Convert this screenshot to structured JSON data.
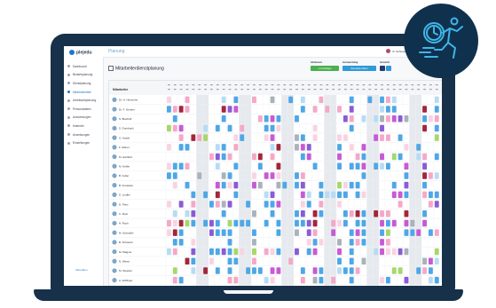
{
  "app": {
    "logo_text": "plejedu",
    "page_title": "Planung",
    "user_label": "R. Schneider · Pflegeheim Musterhaus"
  },
  "sidebar": {
    "items": [
      {
        "label": "Dashboard",
        "active": false
      },
      {
        "label": "Bedarfsplanung",
        "active": false
      },
      {
        "label": "Dienstplanung",
        "active": false
      },
      {
        "label": "Mitarbeiterliste",
        "active": true
      },
      {
        "label": "Arbeitszeitplanung",
        "active": false
      },
      {
        "label": "Personaldaten",
        "active": false
      },
      {
        "label": "Auswertungen",
        "active": false
      },
      {
        "label": "Kalender",
        "active": false
      },
      {
        "label": "Anweisungen",
        "active": false
      },
      {
        "label": "Einstellungen",
        "active": false
      }
    ],
    "logout_label": "Abmelden"
  },
  "toolbar": {
    "plan_title": "Mitarbeiterdienstplanung",
    "group1_label": "Aktionen",
    "group1_button": "+ Hinzufügen",
    "group2_label": "Auswertung",
    "group2_button": "Dienstplan filtern",
    "group3_label": "Ansicht",
    "colors": {
      "green": "#4cb050",
      "blue": "#2f9ad6",
      "navy": "#1f3b72"
    }
  },
  "grid": {
    "header_label": "Mitarbeiter",
    "employees": [
      "Dr. H. Heinrichs",
      "Dr. F. Gerster",
      "S. Bischoff",
      "S. Dornbach",
      "S. Hosek",
      "F. Hiltner",
      "M. Hartfeld",
      "M. Hoffer",
      "B. Koller",
      "B. Kossiedo",
      "D. Lindke",
      "D. Penz",
      "C. Rost",
      "H. Roch",
      "M. Schindler",
      "B. Schwerin",
      "M. Wagner",
      "N. Weiss",
      "M. Wessler",
      "A. Zeffinger"
    ],
    "legend_colors": {
      "blue": "#4ea7e6",
      "lightblue": "#b6dcf5",
      "pink": "#f4a8c7",
      "lightpink": "#f9d3e2",
      "magenta": "#c75ad4",
      "purple": "#8a5bd6",
      "green": "#a6d86a",
      "darkred": "#a3263b",
      "red": "#e2476b",
      "gray": "#a9b2bb",
      "weekend": "#e6e9ed"
    }
  }
}
